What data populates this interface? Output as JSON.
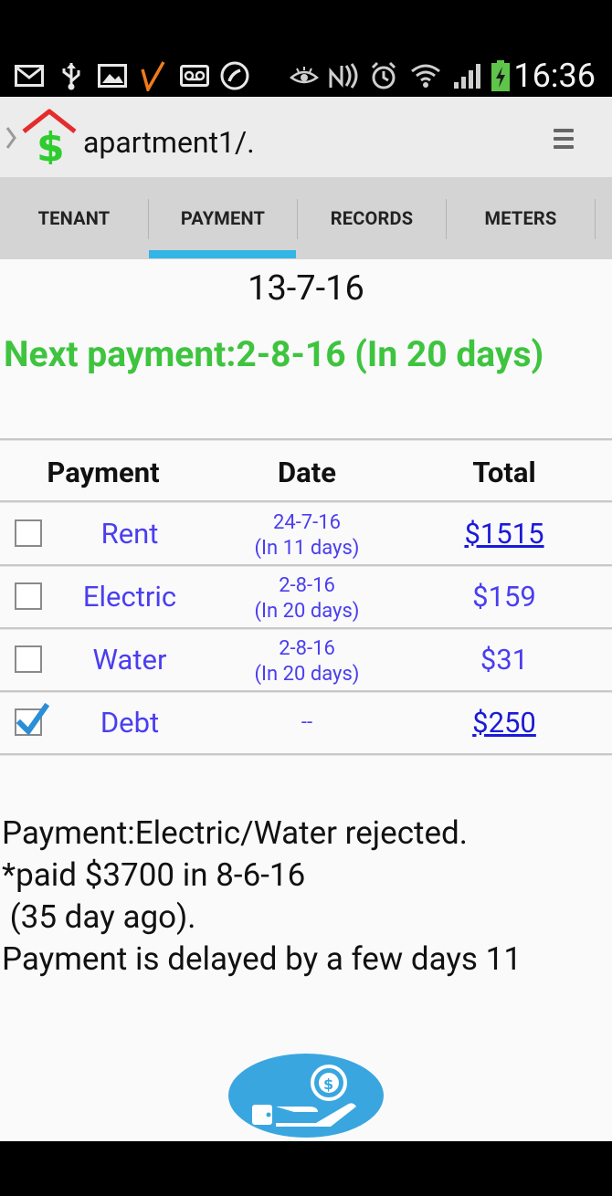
{
  "status_bar": {
    "time": "16:36",
    "icons_left": [
      "email-icon",
      "usb-icon",
      "gallery-icon",
      "v-app-icon",
      "voicemail-icon",
      "call-icon"
    ],
    "icons_right": [
      "eye-icon",
      "nfc-icon",
      "alarm-icon",
      "wifi-icon",
      "signal-icon",
      "battery-charging-icon"
    ]
  },
  "action_bar": {
    "title": "apartment1/.",
    "logo_icon": "house-dollar-icon",
    "menu_icon": "overflow-menu-icon"
  },
  "tabs": [
    {
      "label": "TENANT",
      "selected": false
    },
    {
      "label": "PAYMENT",
      "selected": true
    },
    {
      "label": "RECORDS",
      "selected": false
    },
    {
      "label": "METERS",
      "selected": false
    }
  ],
  "payment": {
    "current_date": "13-7-16",
    "next_payment": "Next payment:2-8-16 (In 20 days)",
    "table": {
      "headers": {
        "payment": "Payment",
        "date": "Date",
        "total": "Total"
      },
      "rows": [
        {
          "name": "Rent",
          "date_line1": "24-7-16",
          "date_line2": "(In 11 days)",
          "total": "$1515",
          "checked": false,
          "total_is_link": true
        },
        {
          "name": "Electric",
          "date_line1": "2-8-16",
          "date_line2": "(In 20 days)",
          "total": "$159",
          "checked": false,
          "total_is_link": false
        },
        {
          "name": "Water",
          "date_line1": "2-8-16",
          "date_line2": "(In 20 days)",
          "total": "$31",
          "checked": false,
          "total_is_link": false
        },
        {
          "name": "Debt",
          "date_line1": "--",
          "date_line2": "",
          "total": "$250",
          "checked": true,
          "total_is_link": true
        }
      ]
    },
    "notes": {
      "line1": "Payment:Electric/Water rejected.",
      "line2": "*paid $3700 in 8-6-16",
      "line3": " (35 day ago).",
      "line4": "Payment is delayed by a few days 11"
    },
    "pay_button_icon": "hand-coin-icon"
  },
  "colors": {
    "accent": "#33b5e5",
    "next_payment_green": "#3ec43e",
    "row_text_blue": "#4a3ef0",
    "link_blue": "#1a1ad8",
    "pay_button": "#3aa6e0",
    "logo_red": "#e52b2b",
    "logo_green": "#2ecc2e"
  }
}
